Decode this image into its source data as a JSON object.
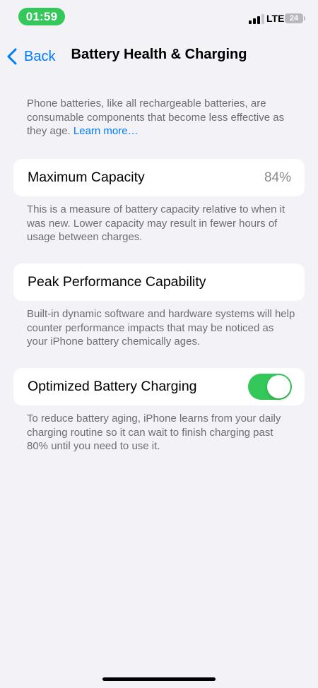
{
  "status_bar": {
    "time": "01:59",
    "network": "LTE",
    "battery_level": "24",
    "accent": "#34c759"
  },
  "nav": {
    "back_label": "Back",
    "title": "Battery Health & Charging",
    "accent": "#007aff"
  },
  "intro": {
    "text": "Phone batteries, like all rechargeable batteries, are consumable components that become less effective as they age.",
    "link_label": "Learn more…"
  },
  "max_capacity": {
    "label": "Maximum Capacity",
    "value": "84%",
    "footnote": "This is a measure of battery capacity relative to when it was new. Lower capacity may result in fewer hours of usage between charges."
  },
  "peak_performance": {
    "label": "Peak Performance Capability",
    "footnote": "Built-in dynamic software and hardware systems will help counter performance impacts that may be noticed as your iPhone battery chemically ages."
  },
  "optimized_charging": {
    "label": "Optimized Battery Charging",
    "enabled": true,
    "footnote": "To reduce battery aging, iPhone learns from your daily charging routine so it can wait to finish charging past 80% until you need to use it."
  }
}
